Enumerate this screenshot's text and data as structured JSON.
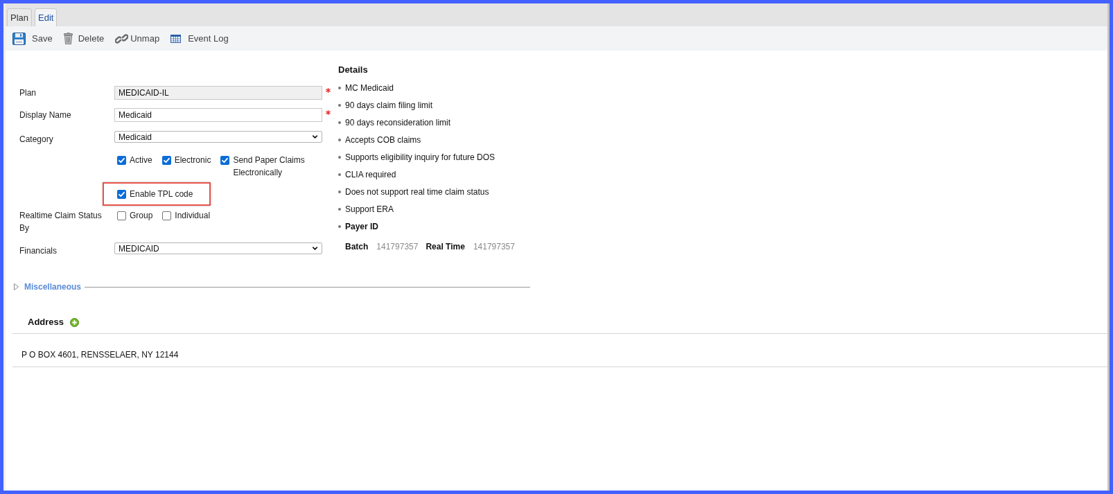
{
  "tabs": [
    {
      "label": "Plan",
      "selected": false
    },
    {
      "label": "Edit",
      "selected": true
    }
  ],
  "toolbar": [
    {
      "kind": "save",
      "label": "Save"
    },
    {
      "kind": "delete",
      "label": "Delete"
    },
    {
      "kind": "unmap",
      "label": "Unmap"
    },
    {
      "kind": "log",
      "label": "Event Log"
    }
  ],
  "form": {
    "fields": [
      {
        "kind": "text",
        "label": "Plan",
        "value": "MEDICAID-IL",
        "disabled": true,
        "required": true
      },
      {
        "kind": "text",
        "label": "Display Name",
        "value": "Medicaid",
        "disabled": false,
        "required": true
      },
      {
        "kind": "select",
        "label": "Category",
        "value": "Medicaid",
        "disabled": false
      },
      {
        "kind": "checks",
        "options": [
          {
            "label": "Active",
            "checked": true
          },
          {
            "label": "Electronic",
            "checked": true
          },
          {
            "label": "Send Paper Claims Electronically",
            "checked": true
          }
        ]
      },
      {
        "kind": "checks",
        "highlighted": true,
        "options": [
          {
            "label": "Enable TPL code",
            "checked": true
          }
        ]
      },
      {
        "kind": "checks",
        "label": "Realtime Claim Status By",
        "options": [
          {
            "label": "Group",
            "checked": false
          },
          {
            "label": "Individual",
            "checked": false
          }
        ]
      },
      {
        "kind": "select",
        "label": "Financials",
        "value": "MEDICAID",
        "disabled": false
      }
    ]
  },
  "details": {
    "title": "Details",
    "items": [
      "MC Medicaid",
      "90 days claim filing limit",
      "90 days reconsideration limit",
      "Accepts COB claims",
      "Supports eligibility inquiry for future DOS",
      "CLIA required",
      "Does not support real time claim status",
      "Support ERA"
    ],
    "payer_id": {
      "label": "Payer ID",
      "values": [
        {
          "label": "Batch",
          "value": "141797357"
        },
        {
          "label": "Real Time",
          "value": "141797357"
        }
      ]
    }
  },
  "misc": {
    "label": "Miscellaneous",
    "expanded": false
  },
  "address": {
    "title": "Address",
    "lines": [
      "P O BOX 4601, RENSSELAER, NY 12144"
    ]
  }
}
